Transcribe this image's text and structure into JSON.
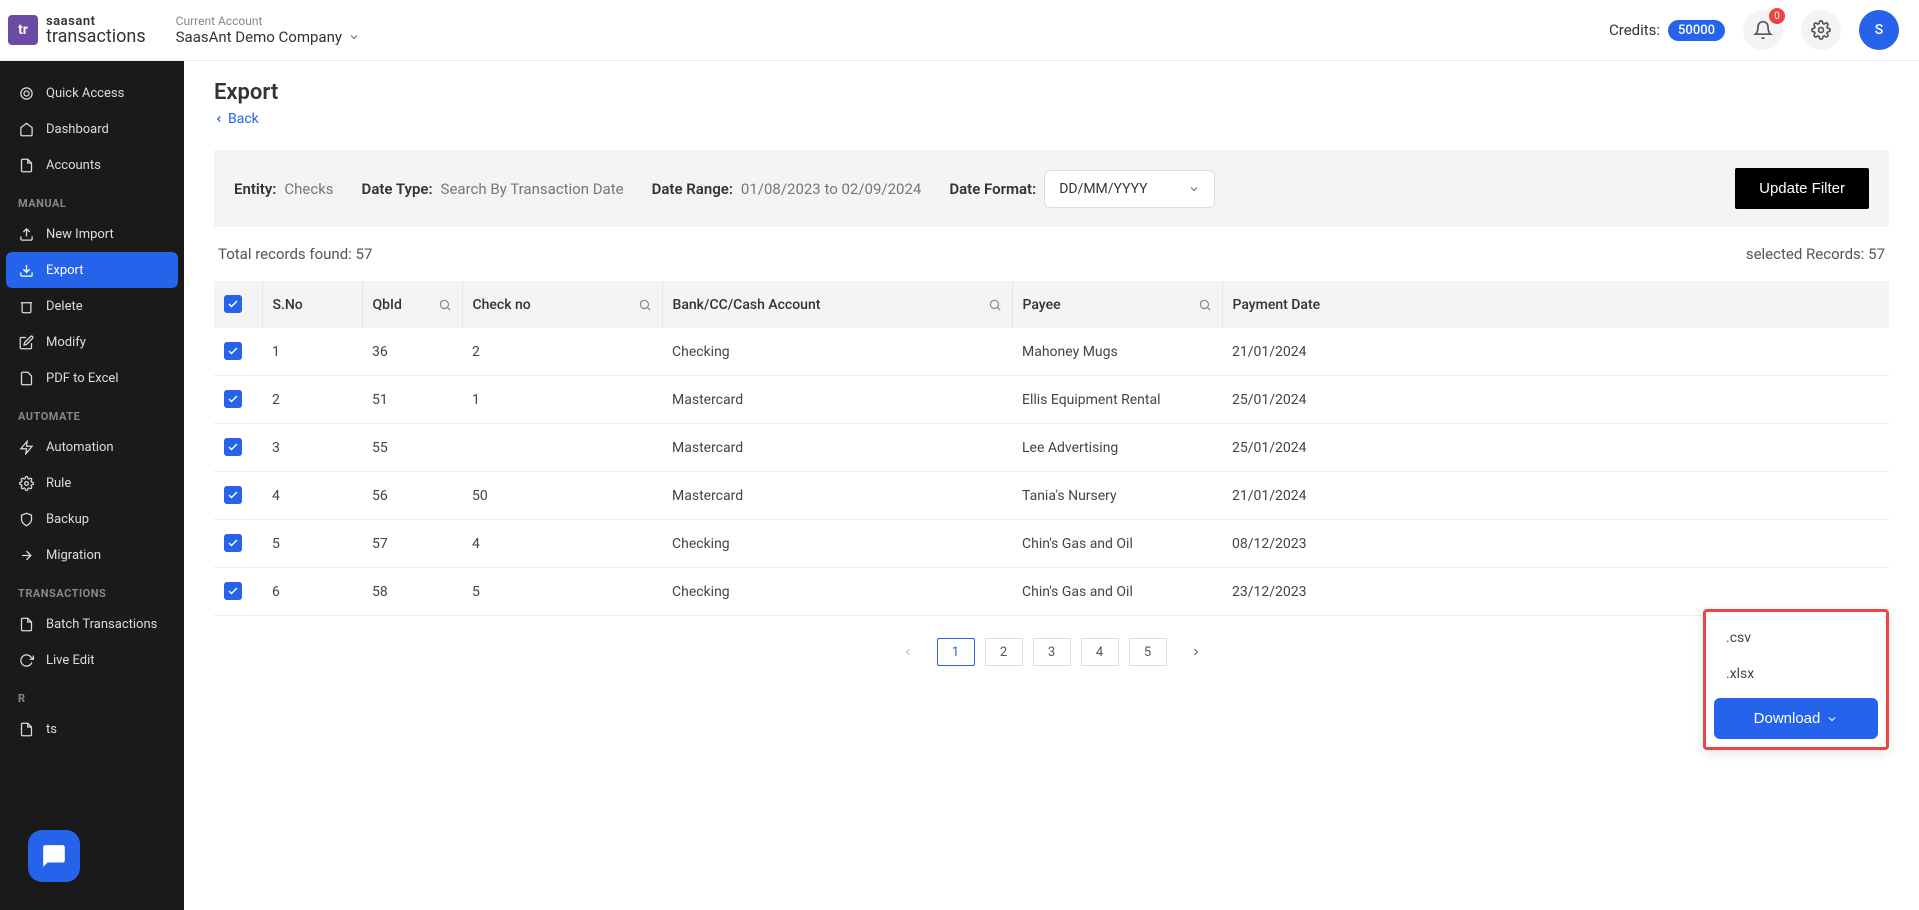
{
  "brand": {
    "mark": "tr",
    "name": "saasant",
    "sub": "transactions"
  },
  "account": {
    "label": "Current Account",
    "name": "SaasAnt Demo Company"
  },
  "topbar": {
    "credits_label": "Credits:",
    "credits_value": "50000",
    "notif_count": "0",
    "avatar_initial": "S"
  },
  "sidebar": {
    "items_top": [
      {
        "label": "Quick Access",
        "icon": "target"
      },
      {
        "label": "Dashboard",
        "icon": "home"
      },
      {
        "label": "Accounts",
        "icon": "doc"
      }
    ],
    "section_manual": "MANUAL",
    "items_manual": [
      {
        "label": "New Import",
        "icon": "upload"
      },
      {
        "label": "Export",
        "icon": "download",
        "active": true
      },
      {
        "label": "Delete",
        "icon": "trash"
      },
      {
        "label": "Modify",
        "icon": "edit"
      },
      {
        "label": "PDF to Excel",
        "icon": "file"
      }
    ],
    "section_automate": "AUTOMATE",
    "items_automate": [
      {
        "label": "Automation",
        "icon": "bolt"
      },
      {
        "label": "Rule",
        "icon": "gear"
      },
      {
        "label": "Backup",
        "icon": "shield"
      },
      {
        "label": "Migration",
        "icon": "arrows"
      }
    ],
    "section_transactions": "TRANSACTIONS",
    "items_transactions": [
      {
        "label": "Batch Transactions",
        "icon": "doc"
      },
      {
        "label": "Live Edit",
        "icon": "refresh"
      }
    ],
    "section_reports": "R",
    "items_reports": [
      {
        "label": "ts",
        "icon": "doc"
      }
    ]
  },
  "page": {
    "title": "Export",
    "back": "Back"
  },
  "filter": {
    "entity_label": "Entity:",
    "entity_value": "Checks",
    "datetype_label": "Date Type:",
    "datetype_value": "Search By Transaction Date",
    "daterange_label": "Date Range:",
    "daterange_value": "01/08/2023 to 02/09/2024",
    "dateformat_label": "Date Format:",
    "dateformat_value": "DD/MM/YYYY",
    "update_btn": "Update Filter"
  },
  "records": {
    "total_label": "Total records found: 57",
    "selected_label": "selected Records: 57"
  },
  "table": {
    "headers": [
      "S.No",
      "QbId",
      "Check no",
      "Bank/CC/Cash Account",
      "Payee",
      "Payment Date"
    ],
    "rows": [
      {
        "sno": "1",
        "qbid": "36",
        "checkno": "2",
        "account": "Checking",
        "payee": "Mahoney Mugs",
        "date": "21/01/2024"
      },
      {
        "sno": "2",
        "qbid": "51",
        "checkno": "1",
        "account": "Mastercard",
        "payee": "Ellis Equipment Rental",
        "date": "25/01/2024"
      },
      {
        "sno": "3",
        "qbid": "55",
        "checkno": "",
        "account": "Mastercard",
        "payee": "Lee Advertising",
        "date": "25/01/2024"
      },
      {
        "sno": "4",
        "qbid": "56",
        "checkno": "50",
        "account": "Mastercard",
        "payee": "Tania's Nursery",
        "date": "21/01/2024"
      },
      {
        "sno": "5",
        "qbid": "57",
        "checkno": "4",
        "account": "Checking",
        "payee": "Chin's Gas and Oil",
        "date": "08/12/2023"
      },
      {
        "sno": "6",
        "qbid": "58",
        "checkno": "5",
        "account": "Checking",
        "payee": "Chin's Gas and Oil",
        "date": "23/12/2023"
      }
    ]
  },
  "pagination": {
    "pages": [
      "1",
      "2",
      "3",
      "4",
      "5"
    ],
    "active": "1"
  },
  "download": {
    "opt_csv": ".csv",
    "opt_xlsx": ".xlsx",
    "button": "Download"
  }
}
